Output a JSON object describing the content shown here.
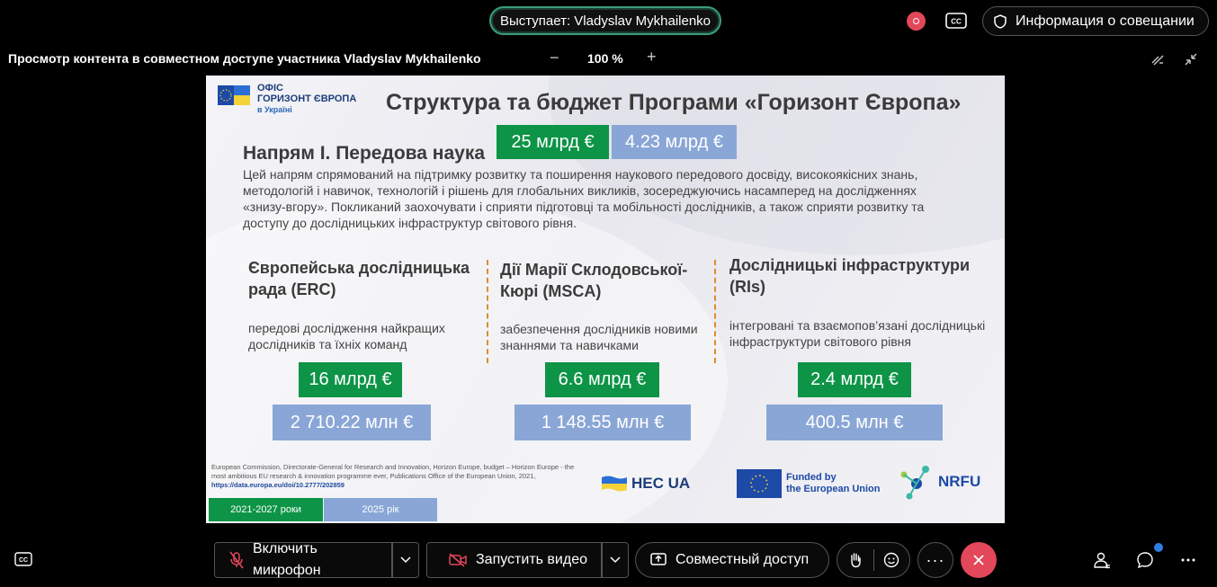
{
  "topbar": {
    "speaker_label": "Выступает: Vladyslav Mykhailenko",
    "meeting_info_label": "Информация о совещании",
    "share_title": "Просмотр контента в совместном доступе участника Vladyslav Mykhailenko",
    "zoom_minus": "−",
    "zoom_level": "100 %",
    "zoom_plus": "+"
  },
  "slide": {
    "logo_line1": "ОФІС",
    "logo_line2": "ГОРИЗОНТ ЄВРОПА",
    "logo_line3": "в Україні",
    "title": "Структура та бюджет Програми «Горизонт Європа»",
    "section_title": "Напрям І. Передова наука",
    "section_budget_2021_2027": "25 млрд €",
    "section_budget_2025": "4.23 млрд €",
    "section_description": "Цей напрям спрямований на підтримку розвитку та поширення наукового передового досвіду, високоякісних знань, методологій і навичок, технологій і рішень для глобальних викликів, зосереджуючись насамперед на дослідженнях «знизу-вгору». Покликаний заохочувати і сприяти підготовці та мобільності дослідників, а також сприяти розвитку та доступу до дослідницьких інфраструктур світового рівня.",
    "columns": [
      {
        "title": "Європейська дослідницька рада (ERC)",
        "text": "передові дослідження найкращих дослідників та їхніх команд",
        "budget_total": "16 млрд €",
        "budget_year": "2 710.22 млн €"
      },
      {
        "title": "Дії Марії Склодовської-Кюрі (MSCA)",
        "text": "забезпечення дослідників новими знаннями та навичками",
        "budget_total": "6.6 млрд €",
        "budget_year": "1 148.55 млн €"
      },
      {
        "title": "Дослідницькі інфраструктури (RIs)",
        "text": "інтегровані та взаємопов’язані дослідницькі інфраструктури світового рівня",
        "budget_total": "2.4 млрд €",
        "budget_year": "400.5 млн €"
      }
    ],
    "footnote_text": "European Commission, Directorate-General for Research and Innovation, Horizon Europe, budget – Horizon Europe - the most ambitious EU research & innovation programme ever, Publications Office of the European Union, 2021,",
    "footnote_link": "https://data.europa.eu/doi/10.2777/202859",
    "legend_green": "2021-2027 роки",
    "legend_blue": "2025 рік",
    "logo_hec": "HEC UA",
    "logo_eu_line1": "Funded by",
    "logo_eu_line2": "the European Union",
    "logo_nrfu": "NRFU",
    "colors": {
      "green": "#0d9447",
      "blue": "#8aa6d6",
      "divider": "#e08b2c"
    }
  },
  "bottombar": {
    "mic_label": "Включить микрофон",
    "video_label": "Запустить видео",
    "share_label": "Совместный доступ",
    "more_label": "···"
  },
  "icons": [
    "cc-icon",
    "shield-icon",
    "mic-off-icon",
    "video-off-icon",
    "share-screen-icon",
    "raise-hand-icon",
    "emoji-icon",
    "end-call-icon",
    "participants-icon",
    "chat-icon",
    "more-icon"
  ]
}
